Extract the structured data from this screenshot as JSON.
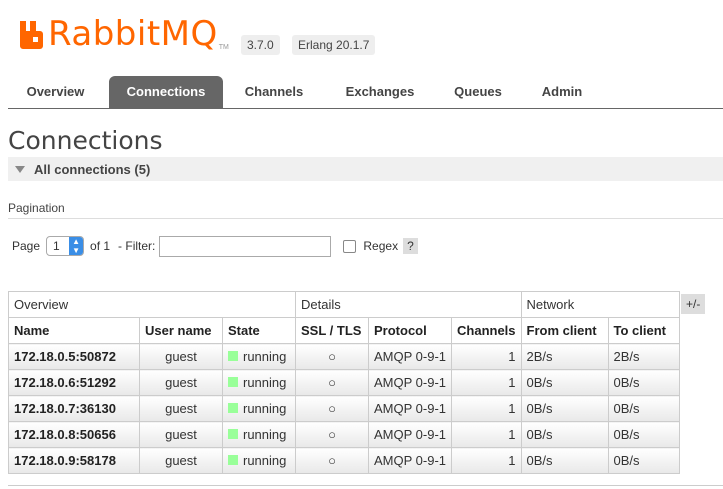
{
  "header": {
    "logo_text": "RabbitMQ",
    "logo_tm": "TM",
    "version": "3.7.0",
    "erlang": "Erlang 20.1.7",
    "brand_color": "#ff6600"
  },
  "tabs": [
    {
      "label": "Overview",
      "active": false
    },
    {
      "label": "Connections",
      "active": true
    },
    {
      "label": "Channels",
      "active": false
    },
    {
      "label": "Exchanges",
      "active": false
    },
    {
      "label": "Queues",
      "active": false
    },
    {
      "label": "Admin",
      "active": false
    }
  ],
  "page_title": "Connections",
  "section": {
    "label": "All connections (5)"
  },
  "pagination": {
    "label": "Pagination",
    "page_label": "Page",
    "page_value": "1",
    "of_label": "of 1",
    "filter_label": "- Filter:",
    "filter_value": "",
    "regex_label": "Regex",
    "help": "?"
  },
  "table": {
    "groups": [
      "Overview",
      "Details",
      "Network"
    ],
    "columns": [
      "Name",
      "User name",
      "State",
      "SSL / TLS",
      "Protocol",
      "Channels",
      "From client",
      "To client"
    ],
    "toggle": "+/-",
    "rows": [
      {
        "name": "172.18.0.5:50872",
        "user": "guest",
        "state": "running",
        "ssl": "○",
        "protocol": "AMQP 0-9-1",
        "channels": "1",
        "from": "2B/s",
        "to": "2B/s"
      },
      {
        "name": "172.18.0.6:51292",
        "user": "guest",
        "state": "running",
        "ssl": "○",
        "protocol": "AMQP 0-9-1",
        "channels": "1",
        "from": "0B/s",
        "to": "0B/s"
      },
      {
        "name": "172.18.0.7:36130",
        "user": "guest",
        "state": "running",
        "ssl": "○",
        "protocol": "AMQP 0-9-1",
        "channels": "1",
        "from": "0B/s",
        "to": "0B/s"
      },
      {
        "name": "172.18.0.8:50656",
        "user": "guest",
        "state": "running",
        "ssl": "○",
        "protocol": "AMQP 0-9-1",
        "channels": "1",
        "from": "0B/s",
        "to": "0B/s"
      },
      {
        "name": "172.18.0.9:58178",
        "user": "guest",
        "state": "running",
        "ssl": "○",
        "protocol": "AMQP 0-9-1",
        "channels": "1",
        "from": "0B/s",
        "to": "0B/s"
      }
    ]
  }
}
